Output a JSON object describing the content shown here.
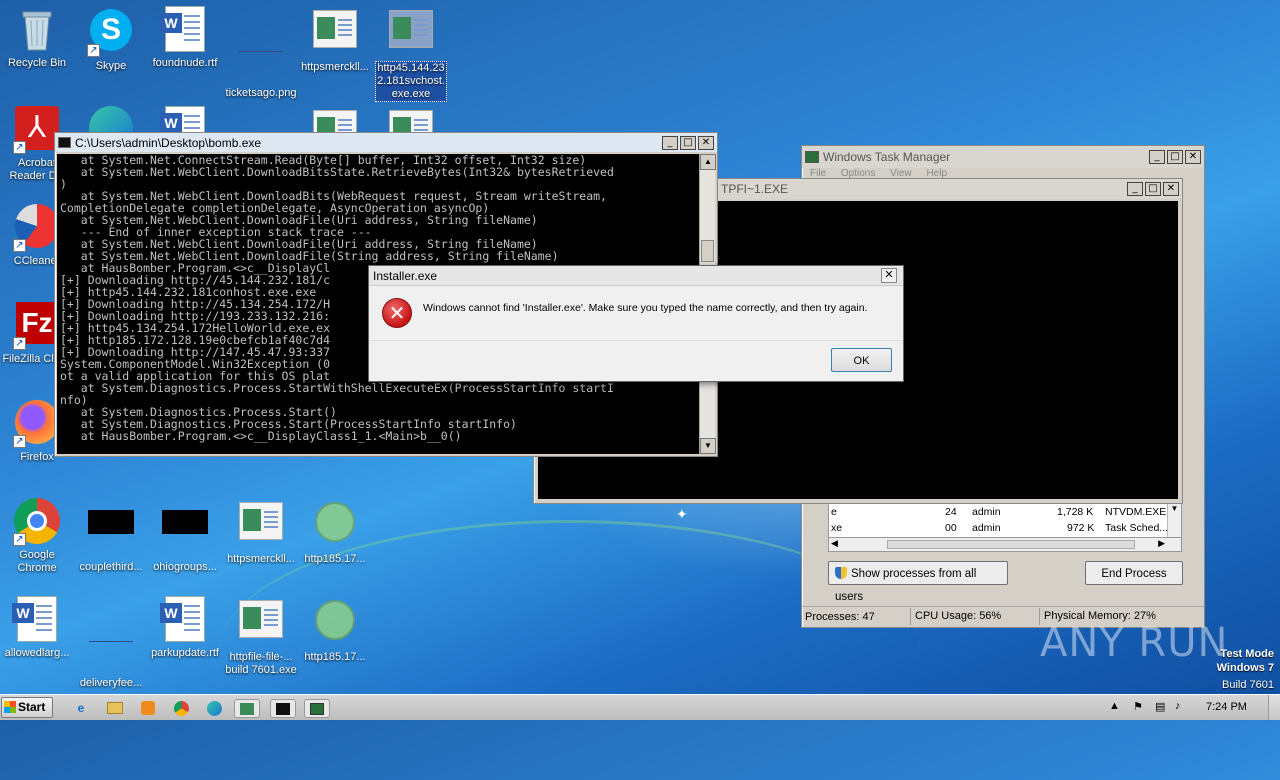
{
  "desktop": {
    "icons": [
      {
        "label": "Recycle Bin"
      },
      {
        "label": "Skype"
      },
      {
        "label": "foundnude.rtf"
      },
      {
        "label": "ticketsago.png"
      },
      {
        "label": "httpsmerckll..."
      },
      {
        "label": "http45.144.23 2.181svchost. exe.exe"
      },
      {
        "label": "Acrobat Reader DC"
      },
      {
        "label": "CCleaner"
      },
      {
        "label": "FileZilla Client"
      },
      {
        "label": "Firefox"
      },
      {
        "label": "Google Chrome"
      },
      {
        "label": "couplethird..."
      },
      {
        "label": "ohiogroups..."
      },
      {
        "label": "httpsmerckll..."
      },
      {
        "label": "http185.17..."
      },
      {
        "label": "allowedlarg..."
      },
      {
        "label": "deliveryfee..."
      },
      {
        "label": "parkupdate.rtf"
      },
      {
        "label": "httpfile-file-... build 7601.exe"
      },
      {
        "label": "http185.17..."
      }
    ]
  },
  "console_window": {
    "title": "C:\\Users\\admin\\Desktop\\bomb.exe",
    "lines": [
      "   at System.Net.ConnectStream.Read(Byte[] buffer, Int32 offset, Int32 size)",
      "   at System.Net.WebClient.DownloadBitsState.RetrieveBytes(Int32& bytesRetrieved",
      ")",
      "   at System.Net.WebClient.DownloadBits(WebRequest request, Stream writeStream,",
      "CompletionDelegate completionDelegate, AsyncOperation asyncOp)",
      "   at System.Net.WebClient.DownloadFile(Uri address, String fileName)",
      "   --- End of inner exception stack trace ---",
      "   at System.Net.WebClient.DownloadFile(Uri address, String fileName)",
      "   at System.Net.WebClient.DownloadFile(String address, String fileName)",
      "   at HausBomber.Program.<>c__DisplayCl",
      "[+] Downloading http://45.144.232.181/c",
      "[+] http45.144.232.181conhost.exe.exe",
      "[+] Downloading http://45.134.254.172/H",
      "[+] Downloading http://193.233.132.216:",
      "[+] http45.134.254.172HelloWorld.exe.ex",
      "[+] http185.172.128.19e0cbefcb1af40c7d4",
      "[+] Downloading http://147.45.47.93:337",
      "System.ComponentModel.Win32Exception (0",
      "ot a valid application for this OS plat",
      "   at System.Diagnostics.Process.StartWithShellExecuteEx(ProcessStartInfo startI",
      "nfo)",
      "   at System.Diagnostics.Process.Start()",
      "   at System.Diagnostics.Process.Start(ProcessStartInfo startInfo)",
      "   at HausBomber.Program.<>c__DisplayClass1_1.<Main>b__0()"
    ]
  },
  "ntvdm_window": {
    "title": "TPFI~1.EXE"
  },
  "task_manager": {
    "title": "Windows Task Manager",
    "menu": [
      "File",
      "Options",
      "View",
      "Help"
    ],
    "rows": [
      {
        "name": "e",
        "cpu": "24",
        "user": "admin",
        "mem": "1,728 K",
        "desc": "NTVDM.EXE"
      },
      {
        "name": "xe",
        "cpu": "00",
        "user": "admin",
        "mem": "972 K",
        "desc": "Task Sched..."
      }
    ],
    "show_all_label": "Show processes from all users",
    "end_process_label": "End Process",
    "status": {
      "processes": "Processes: 47",
      "cpu": "CPU Usage: 56%",
      "memory": "Physical Memory: 27%"
    }
  },
  "dialog": {
    "title": "Installer.exe",
    "message": "Windows cannot find 'Installer.exe'. Make sure you typed the name correctly, and then try again.",
    "ok_label": "OK"
  },
  "watermark": {
    "brand": "ANY RUN",
    "test_mode": "Test Mode",
    "os": "Windows 7",
    "build": "Build 7601"
  },
  "taskbar": {
    "start_label": "Start",
    "clock": "7:24 PM"
  }
}
